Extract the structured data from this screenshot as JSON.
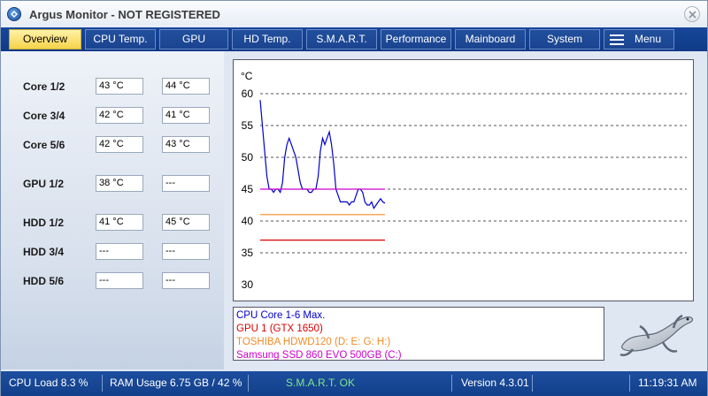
{
  "window": {
    "title": "Argus Monitor - NOT REGISTERED"
  },
  "tabs": [
    "Overview",
    "CPU Temp.",
    "GPU",
    "HD Temp.",
    "S.M.A.R.T.",
    "Performance",
    "Mainboard",
    "System",
    "Menu"
  ],
  "active_tab": "Overview",
  "sensors": [
    {
      "label": "Core 1/2",
      "a": "43 °C",
      "b": "44 °C"
    },
    {
      "label": "Core 3/4",
      "a": "42 °C",
      "b": "41 °C"
    },
    {
      "label": "Core 5/6",
      "a": "42 °C",
      "b": "43 °C"
    },
    {
      "label": "GPU 1/2",
      "a": "38 °C",
      "b": "---"
    },
    {
      "label": "HDD 1/2",
      "a": "41 °C",
      "b": "45 °C"
    },
    {
      "label": "HDD 3/4",
      "a": "---",
      "b": "---"
    },
    {
      "label": "HDD 5/6",
      "a": "---",
      "b": "---"
    }
  ],
  "chart_data": {
    "type": "line",
    "unit_label": "°C",
    "ylim": [
      30,
      60
    ],
    "yticks": [
      60,
      55,
      50,
      45,
      40,
      35,
      30
    ],
    "grid": "horizontal dashed",
    "series": [
      {
        "name": "CPU Core 1-6 Max.",
        "color": "#0000cc",
        "values": [
          59,
          55,
          51,
          47,
          45,
          45,
          44.5,
          45,
          45,
          44.5,
          46,
          50,
          52,
          53,
          52,
          51,
          50,
          48,
          46,
          45,
          45,
          45,
          44.5,
          44.5,
          45,
          45,
          47,
          51,
          53,
          52,
          53,
          54,
          52,
          49,
          45,
          44,
          43,
          43,
          43,
          43,
          42.5,
          43,
          43,
          44,
          45,
          45,
          44.5,
          43,
          42.5,
          42.5,
          43,
          42,
          42.5,
          43,
          43.5,
          43,
          42.8
        ]
      },
      {
        "name": "GPU 1 (GTX 1650)",
        "color": "#dd0000",
        "values": [
          37,
          37
        ]
      },
      {
        "name": "TOSHIBA HDWD120 (D: E: G: H:)",
        "color": "#f08c28",
        "values": [
          41,
          41
        ]
      },
      {
        "name": "Samsung SSD 860 EVO 500GB (C:)",
        "color": "#cc00cc",
        "values": [
          45,
          45
        ]
      }
    ]
  },
  "status": {
    "cpu_load": "CPU Load 8.3 %",
    "ram_usage": "RAM Usage 6.75 GB / 42 %",
    "smart": "S.M.A.R.T. OK",
    "version": "Version 4.3.01",
    "time": "11:19:31 AM"
  },
  "colors": {
    "smart_ok": "#7fe58a",
    "tab_active": "#f6d34a",
    "tabbar": "#17479b"
  },
  "icons": {
    "app": "argus-logo-icon",
    "close": "close-icon",
    "menu": "hamburger-icon",
    "mascot": "gecko-mascot"
  }
}
